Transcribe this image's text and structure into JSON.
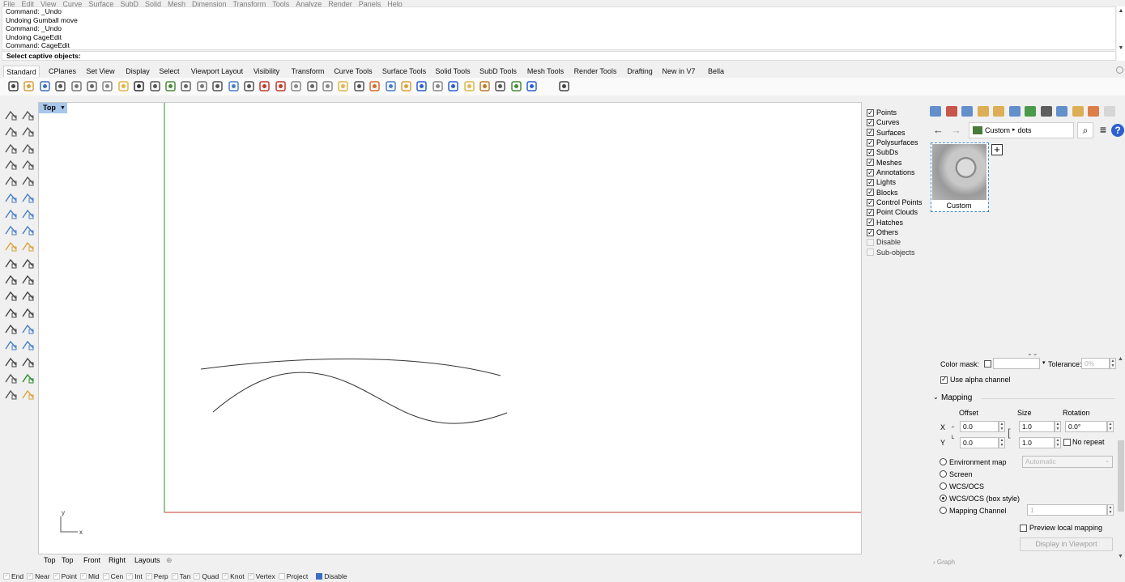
{
  "menubar": [
    "File",
    "Edit",
    "View",
    "Curve",
    "Surface",
    "SubD",
    "Solid",
    "Mesh",
    "Dimension",
    "Transform",
    "Tools",
    "Analyze",
    "Render",
    "Panels",
    "Help"
  ],
  "command": {
    "history": [
      "Command: _Undo",
      "Undoing Gumball move",
      "Command: _Undo",
      "Undoing CageEdit",
      "Command: CageEdit"
    ],
    "prompt": "Select captive objects:"
  },
  "tabs": [
    "Standard",
    "CPlanes",
    "Set View",
    "Display",
    "Select",
    "Viewport Layout",
    "Visibility",
    "Transform",
    "Curve Tools",
    "Surface Tools",
    "Solid Tools",
    "SubD Tools",
    "Mesh Tools",
    "Render Tools",
    "Drafting",
    "New in V7",
    "Bella"
  ],
  "toolbar_icons": [
    "new-icon",
    "open-icon",
    "save-icon",
    "print-icon",
    "import-icon",
    "cut-icon",
    "copy-icon",
    "paste-icon",
    "undo-icon",
    "pan-icon",
    "rotate-view-icon",
    "zoom-icon",
    "zoom-window-icon",
    "zoom-extents-icon",
    "zoom-selected-icon",
    "undo-view-icon",
    "four-view-icon",
    "car-icon",
    "grid-snap-icon",
    "ortho-icon",
    "planar-icon",
    "light-icon",
    "lock-icon",
    "layer-icon",
    "properties-icon",
    "material-icon",
    "render-sphere-icon",
    "shaded-sphere-icon",
    "rendered-sphere-icon",
    "select-filter-icon",
    "options-icon",
    "history-icon",
    "environment-icon",
    "help-icon",
    "bella-icon"
  ],
  "viewport": {
    "title": "Top",
    "axis_x": "x",
    "axis_y": "y"
  },
  "viewport_tabs": [
    "Top",
    "Top",
    "Front",
    "Right",
    "Layouts"
  ],
  "selection_filter": [
    {
      "label": "Points",
      "checked": true
    },
    {
      "label": "Curves",
      "checked": true
    },
    {
      "label": "Surfaces",
      "checked": true
    },
    {
      "label": "Polysurfaces",
      "checked": true
    },
    {
      "label": "SubDs",
      "checked": true
    },
    {
      "label": "Meshes",
      "checked": true
    },
    {
      "label": "Annotations",
      "checked": true
    },
    {
      "label": "Lights",
      "checked": true
    },
    {
      "label": "Blocks",
      "checked": true
    },
    {
      "label": "Control Points",
      "checked": true
    },
    {
      "label": "Point Clouds",
      "checked": true
    },
    {
      "label": "Hatches",
      "checked": true
    },
    {
      "label": "Others",
      "checked": true
    },
    {
      "label": "Disable",
      "checked": false
    },
    {
      "label": "Sub-objects",
      "checked": false
    }
  ],
  "panel": {
    "breadcrumb_root": "Custom",
    "breadcrumb_sep": "▸",
    "breadcrumb_leaf": "dots",
    "thumbnail_label": "Custom",
    "color_mask_label": "Color mask:",
    "tolerance_label": "Tolerance:",
    "tolerance_value": "0%",
    "use_alpha_label": "Use alpha channel",
    "use_alpha_checked": true,
    "mapping_label": "Mapping",
    "offset_label": "Offset",
    "size_label": "Size",
    "rotation_label": "Rotation",
    "x_label": "X",
    "y_label": "Y",
    "offset_x": "0.0",
    "offset_y": "0.0",
    "size_x": "1.0",
    "size_y": "1.0",
    "rotation": "0.0°",
    "no_repeat_label": "No repeat",
    "mapping_options": [
      {
        "label": "Environment map",
        "selected": false
      },
      {
        "label": "Screen",
        "selected": false
      },
      {
        "label": "WCS/OCS",
        "selected": false
      },
      {
        "label": "WCS/OCS (box style)",
        "selected": true
      },
      {
        "label": "Mapping Channel",
        "selected": false
      }
    ],
    "environment_map_value": "Automatic",
    "mapping_channel_value": "1",
    "preview_local_label": "Preview local mapping",
    "display_viewport_label": "Display in Viewport"
  },
  "osnap": [
    {
      "label": "End",
      "checked": true
    },
    {
      "label": "Near",
      "checked": true
    },
    {
      "label": "Point",
      "checked": true
    },
    {
      "label": "Mid",
      "checked": true
    },
    {
      "label": "Cen",
      "checked": true
    },
    {
      "label": "Int",
      "checked": true
    },
    {
      "label": "Perp",
      "checked": true
    },
    {
      "label": "Tan",
      "checked": true
    },
    {
      "label": "Quad",
      "checked": true
    },
    {
      "label": "Knot",
      "checked": true
    },
    {
      "label": "Vertex",
      "checked": true
    },
    {
      "label": "Project",
      "checked": false
    },
    {
      "label": "Disable",
      "checked": false
    }
  ],
  "colors": {
    "x_axis": "#c0392b",
    "y_axis": "#2e8b2e",
    "viewport_label_bg": "#a8c7ea",
    "selection_outline": "#3b8ed6"
  }
}
